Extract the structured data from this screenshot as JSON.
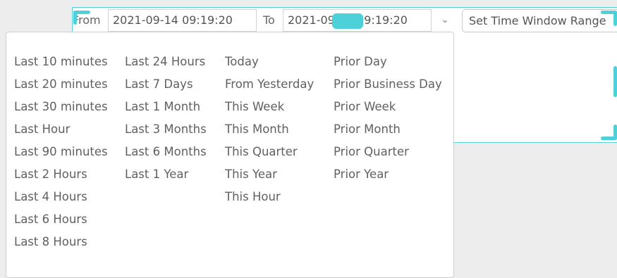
{
  "time_range": {
    "from_label": "From",
    "from_value": "2021-09-14 09:19:20",
    "to_label": "To",
    "to_value": "2021-09-14 09:19:20",
    "dropdown_icon": "chevron-down-icon",
    "set_button_label": "Set Time Window Range"
  },
  "presets": {
    "columns": [
      [
        "Last 10 minutes",
        "Last 20 minutes",
        "Last 30 minutes",
        "Last Hour",
        "Last 90 minutes",
        "Last 2 Hours",
        "Last 4 Hours",
        "Last 6 Hours",
        "Last 8 Hours"
      ],
      [
        "Last 24 Hours",
        "Last 7 Days",
        "Last 1 Month",
        "Last 3 Months",
        "Last 6 Months",
        "Last 1 Year"
      ],
      [
        "Today",
        "From Yesterday",
        "This Week",
        "This Month",
        "This Quarter",
        "This Year",
        "This Hour"
      ],
      [
        "Prior Day",
        "Prior Business Day",
        "Prior Week",
        "Prior Month",
        "Prior Quarter",
        "Prior Year"
      ]
    ]
  },
  "colors": {
    "selection_accent": "#4ed0d8",
    "background": "#ededed",
    "text": "#606060"
  }
}
